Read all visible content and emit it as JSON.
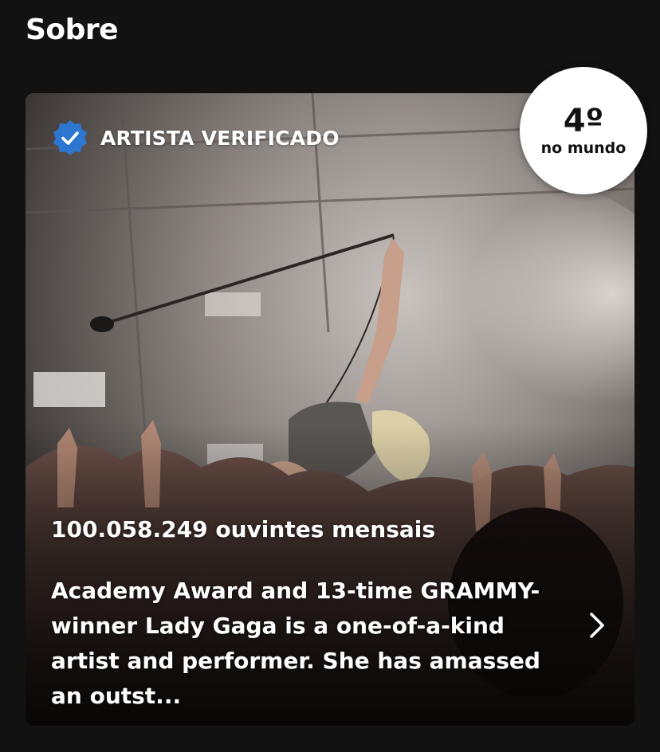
{
  "section": {
    "title": "Sobre"
  },
  "card": {
    "verified_label": "ARTISTA VERIFICADO",
    "rank": {
      "number": "4º",
      "caption": "no mundo"
    },
    "monthly_listeners": "100.058.249 ouvintes mensais",
    "bio": "Academy Award and 13-time GRAMMY-winner Lady Gaga is a one-of-a-kind artist and performer. She has amassed an outst...",
    "image": "concert-performer-photo",
    "colors": {
      "verified_badge": "#2e77d0",
      "background": "#121212",
      "rank_badge": "#ffffff"
    }
  },
  "icons": {
    "verified": "verified-badge-icon",
    "chevron": "chevron-right-icon"
  }
}
